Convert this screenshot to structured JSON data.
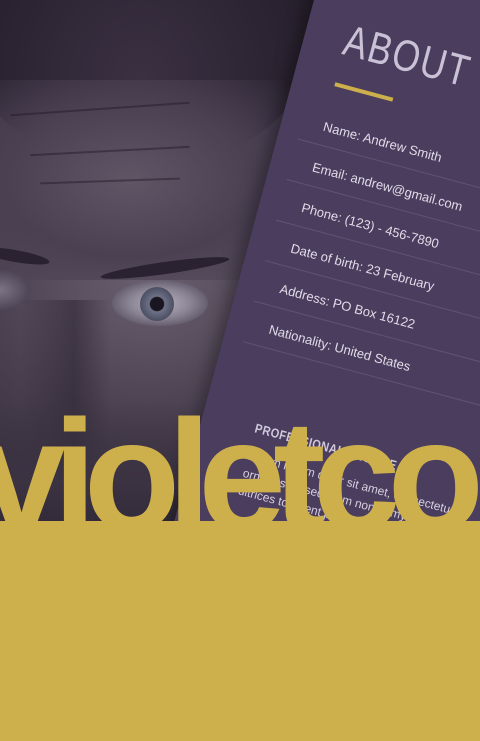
{
  "card": {
    "title": "ABOUT",
    "info": [
      "Name: Andrew Smith",
      "Email: andrew@gmail.com",
      "Phone: (123) - 456-7890",
      "Date of birth: 23 February",
      "Address: PO Box 16122",
      "Nationality: United States"
    ],
    "section_title": "PROFESSIONAL PROFILE",
    "paragraph": [
      "Lorem ipsum dolor sit amet, consectetur",
      "ornare sem sed diam nonummy",
      "ultrices torquent per. Curabitur purus sapien"
    ]
  },
  "wordmark": "violetco",
  "colors": {
    "accent": "#cdb04c",
    "card": "#4a3d5e",
    "photo_dark": "#2a2230"
  }
}
